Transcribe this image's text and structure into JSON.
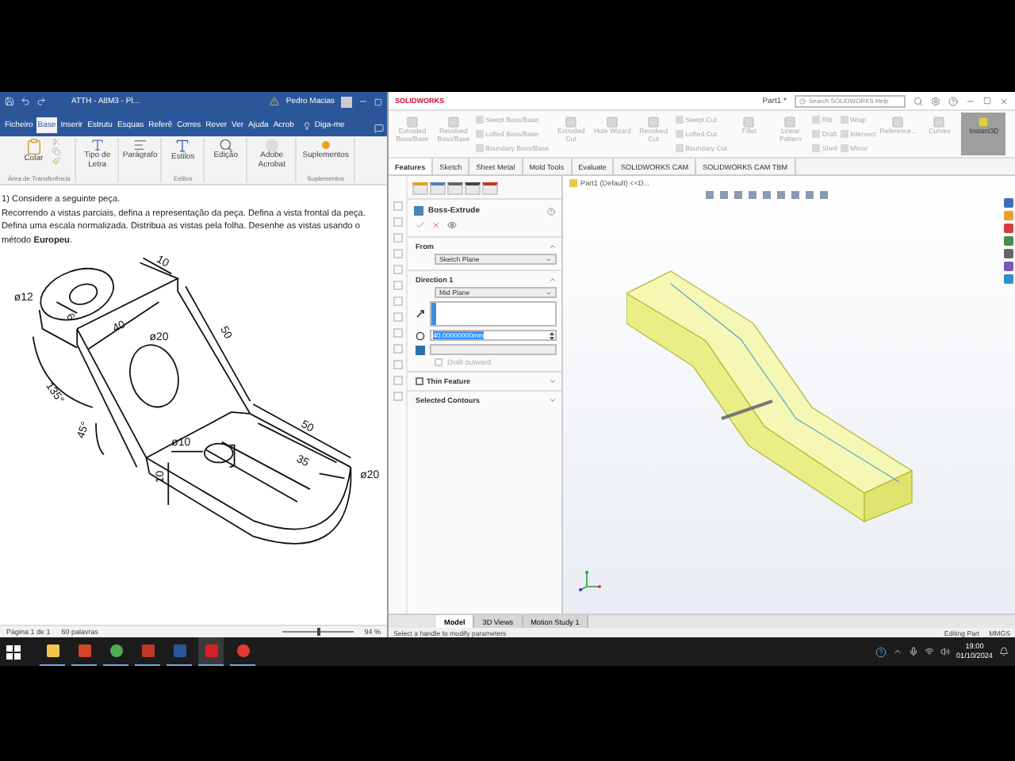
{
  "word": {
    "title": "ATTH - A8M3 - Pl...",
    "user": "Pedro Macias",
    "tell_me": "Diga-me",
    "tabs": [
      {
        "label": "Ficheiro",
        "selected": false
      },
      {
        "label": "Base",
        "selected": true
      },
      {
        "label": "Inserir",
        "selected": false
      },
      {
        "label": "Estrutu",
        "selected": false
      },
      {
        "label": "Esquas",
        "selected": false
      },
      {
        "label": "Referê",
        "selected": false
      },
      {
        "label": "Corres",
        "selected": false
      },
      {
        "label": "Rever",
        "selected": false
      },
      {
        "label": "Ver",
        "selected": false
      },
      {
        "label": "Ajuda",
        "selected": false
      },
      {
        "label": "Acrob",
        "selected": false
      }
    ],
    "ribbon_groups": [
      {
        "label": "Área de Transferência",
        "buttons": [
          {
            "kind": "paste",
            "label": "Colar"
          }
        ]
      },
      {
        "buttons": [
          {
            "kind": "font",
            "label": "Tipo de Letra"
          }
        ]
      },
      {
        "buttons": [
          {
            "kind": "paragraph",
            "label": "Parágrafo"
          }
        ]
      },
      {
        "label": "Estilos",
        "buttons": [
          {
            "kind": "styles",
            "label": "Estilos"
          }
        ]
      },
      {
        "buttons": [
          {
            "kind": "edit",
            "label": "Edição"
          }
        ]
      },
      {
        "buttons": [
          {
            "kind": "acrobat",
            "label": "Adobe Acrobat"
          }
        ]
      },
      {
        "label": "Suplementos",
        "buttons": [
          {
            "kind": "addins",
            "label": "Suplementos"
          }
        ]
      }
    ],
    "document": {
      "heading": "1) Considere a seguinte peça.",
      "paragraph": "Recorrendo a vistas parciais, defina a representação da peça. Defina a vista frontal da peça. Defina uma escala normalizada. Distribua as vistas pela folha. Desenhe as vistas usando o método **Europeu**.",
      "drawing_labels": [
        "10",
        "ø12",
        "6",
        "40",
        "ø20",
        "50",
        "135°",
        "45°",
        "ø10",
        "10",
        "50",
        "35",
        "ø20"
      ]
    },
    "status_bar": {
      "page": "Página 1 de 1",
      "words": "60 palavras",
      "zoom": "94 %",
      "zoom_slider": {
        "level": 0.5
      }
    }
  },
  "solidworks": {
    "brand": "SOLIDWORKS",
    "document": "Part1 *",
    "search": {
      "placeholder": "Search SOLIDWORKS Help"
    },
    "commands": [
      {
        "kind": "big",
        "items": [
          {
            "label": "Extruded Boss/Base",
            "disabled": true
          }
        ]
      },
      {
        "kind": "big",
        "items": [
          {
            "label": "Revolved Boss/Base",
            "disabled": true
          }
        ]
      },
      {
        "kind": "stack",
        "items": [
          {
            "label": "Swept Boss/Base",
            "disabled": true
          },
          {
            "label": "Lofted Boss/Base",
            "disabled": true
          },
          {
            "label": "Boundary Boss/Base",
            "disabled": true
          }
        ]
      },
      {
        "kind": "big",
        "items": [
          {
            "label": "Extruded Cut",
            "disabled": true
          }
        ]
      },
      {
        "kind": "big",
        "items": [
          {
            "label": "Hole Wizard",
            "disabled": true
          }
        ]
      },
      {
        "kind": "big",
        "items": [
          {
            "label": "Revolved Cut",
            "disabled": true
          }
        ]
      },
      {
        "kind": "stack",
        "items": [
          {
            "label": "Swept Cut",
            "disabled": true
          },
          {
            "label": "Lofted Cut",
            "disabled": true
          },
          {
            "label": "Boundary Cut",
            "disabled": true
          }
        ]
      },
      {
        "kind": "big",
        "items": [
          {
            "label": "Fillet",
            "disabled": true
          }
        ]
      },
      {
        "kind": "big",
        "items": [
          {
            "label": "Linear Pattern",
            "disabled": true
          }
        ]
      },
      {
        "kind": "stack",
        "items": [
          {
            "label": "Rib",
            "disabled": true
          },
          {
            "label": "Draft",
            "disabled": true
          },
          {
            "label": "Shell",
            "disabled": true
          }
        ]
      },
      {
        "kind": "stack",
        "items": [
          {
            "label": "Wrap",
            "disabled": true
          },
          {
            "label": "Intersect",
            "disabled": true
          },
          {
            "label": "Mirror",
            "disabled": true
          }
        ]
      },
      {
        "kind": "big",
        "items": [
          {
            "label": "Reference...",
            "disabled": true
          }
        ]
      },
      {
        "kind": "big",
        "items": [
          {
            "label": "Curves",
            "disabled": true
          }
        ]
      },
      {
        "kind": "toggle",
        "items": [
          {
            "label": "Instant3D",
            "disabled": false,
            "selected": true
          }
        ]
      }
    ],
    "tabs": [
      {
        "label": "Features",
        "selected": true
      },
      {
        "label": "Sketch",
        "selected": false
      },
      {
        "label": "Sheet Metal",
        "selected": false
      },
      {
        "label": "Mold Tools",
        "selected": false
      },
      {
        "label": "Evaluate",
        "selected": false
      },
      {
        "label": "SOLIDWORKS CAM",
        "selected": false
      },
      {
        "label": "SOLIDWORKS CAM TBM",
        "selected": false
      }
    ],
    "tree_item": "Part1 (Default) <<D...",
    "property_manager": {
      "title": "Boss-Extrude",
      "sections": [
        {
          "kind": "from",
          "title": "From",
          "expanded": true,
          "value": "Sketch Plane"
        },
        {
          "kind": "direction",
          "title": "Direction 1",
          "expanded": true,
          "value": "Mid Plane",
          "depth": "40.00000000mm",
          "draft": {
            "label": "Draft outward",
            "checked": false,
            "disabled": true
          }
        },
        {
          "kind": "check",
          "title": "Thin Feature",
          "expanded": false,
          "checked": false
        },
        {
          "kind": "plain",
          "title": "Selected Contours",
          "expanded": false
        }
      ]
    },
    "bottom_tabs": [
      {
        "label": "Model",
        "selected": true
      },
      {
        "label": "3D Views",
        "selected": false
      },
      {
        "label": "Motion Study 1",
        "selected": false
      }
    ],
    "status": {
      "message": "Select a handle to modify parameters",
      "mode": "Editing Part",
      "units": "MMGS"
    }
  },
  "taskbar": {
    "apps": [
      {
        "kind": "explorer",
        "selected": false
      },
      {
        "kind": "powerpoint",
        "selected": false
      },
      {
        "kind": "chrome",
        "selected": false
      },
      {
        "kind": "tool",
        "selected": false
      },
      {
        "kind": "word",
        "selected": false
      },
      {
        "kind": "solidworks",
        "selected": true
      },
      {
        "kind": "recorder",
        "selected": false
      }
    ],
    "time": "19:00",
    "date": "01/10/2024"
  }
}
